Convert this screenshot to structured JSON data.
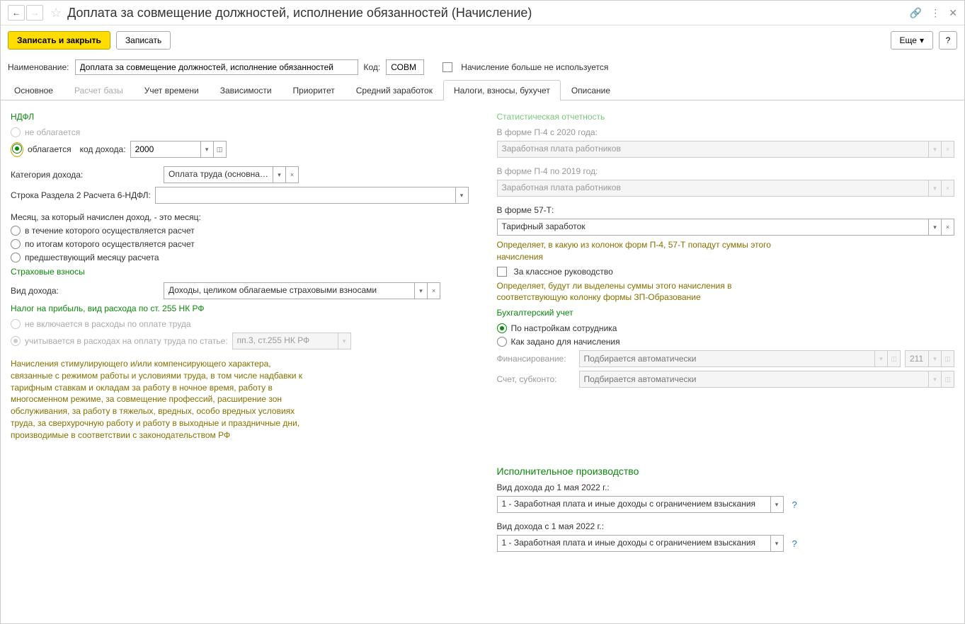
{
  "title": "Доплата за совмещение должностей, исполнение обязанностей (Начисление)",
  "toolbar": {
    "save_close": "Записать и закрыть",
    "save": "Записать",
    "more": "Еще",
    "help": "?"
  },
  "header": {
    "name_label": "Наименование:",
    "name_value": "Доплата за совмещение должностей, исполнение обязанностей",
    "code_label": "Код:",
    "code_value": "СОВМ",
    "unused_label": "Начисление больше не используется"
  },
  "tabs": {
    "t1": "Основное",
    "t2": "Расчет базы",
    "t3": "Учет времени",
    "t4": "Зависимости",
    "t5": "Приоритет",
    "t6": "Средний заработок",
    "t7": "Налоги, взносы, бухучет",
    "t8": "Описание"
  },
  "left": {
    "ndfl_title": "НДФЛ",
    "ndfl_not_taxed": "не облагается",
    "ndfl_taxed": "облагается",
    "income_code_label": "код дохода:",
    "income_code": "2000",
    "income_cat_label": "Категория дохода:",
    "income_cat": "Оплата труда (основная н",
    "row6_label": "Строка Раздела 2 Расчета 6-НДФЛ:",
    "month_label": "Месяц, за который начислен доход, - это месяц:",
    "month_r1": "в течение которого осуществляется расчет",
    "month_r2": "по итогам которого осуществляется расчет",
    "month_r3": "предшествующий месяцу расчета",
    "insurance_title": "Страховые взносы",
    "income_type_label": "Вид дохода:",
    "income_type": "Доходы, целиком облагаемые страховыми взносами",
    "profit_title": "Налог на прибыль, вид расхода по ст. 255 НК РФ",
    "profit_r1": "не включается в расходы по оплате труда",
    "profit_r2": "учитывается в расходах на оплату труда по статье:",
    "profit_article": "пп.3, ст.255 НК РФ",
    "hint1": "Начисления стимулирующего и/или компенсирующего характера, связанные с режимом работы и условиями труда, в том числе надбавки к тарифным ставкам и окладам за работу в ночное время, работу в многосменном режиме, за совмещение профессий, расширение зон обслуживания, за работу в тяжелых, вредных, особо вредных условиях труда, за сверхурочную работу и работу в выходные и праздничные дни, производимые в соответствии с законодательством РФ"
  },
  "right": {
    "stat_title": "Статистическая отчетность",
    "p4_2020_label": "В форме П-4 с 2020 года:",
    "wage_workers": "Заработная плата работников",
    "p4_2019_label": "В форме П-4 по 2019 год:",
    "f57t_label": "В форме 57-Т:",
    "f57t_value": "Тарифный заработок",
    "stat_hint": "Определяет, в какую из колонок форм П-4, 57-Т попадут суммы этого начисления",
    "class_check": "За классное руководство",
    "class_hint": "Определяет, будут ли выделены суммы этого начисления в соответствующую колонку формы ЗП-Образование",
    "acc_title": "Бухгалтерский учет",
    "acc_r1": "По настройкам сотрудника",
    "acc_r2": "Как задано для начисления",
    "fin_label": "Финансирование:",
    "auto_placeholder": "Подбирается автоматически",
    "fin_code": "211",
    "acct_label": "Счет, субконто:",
    "exec_title": "Исполнительное производство",
    "exec_before_label": "Вид дохода до 1 мая 2022 г.:",
    "exec_value": "1 - Заработная плата и иные доходы с ограничением взыскания",
    "exec_after_label": "Вид дохода с 1 мая 2022 г.:"
  }
}
